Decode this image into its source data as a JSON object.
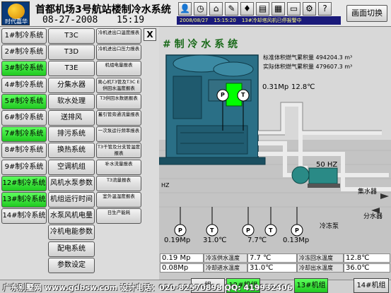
{
  "header": {
    "logo_text": "时代嘉华",
    "title": "首都机场3号航站楼制冷水系统",
    "date": "08-27-2008",
    "time": "15:19",
    "status_date": "2008/08/27",
    "status_time": "15:15:20",
    "status_message": "13#冷却塔风机已停报警中",
    "switch_button": "画面切换"
  },
  "menu": {
    "systems": [
      {
        "label": "1#制冷系统",
        "active": false
      },
      {
        "label": "2#制冷系统",
        "active": false
      },
      {
        "label": "3#制冷系统",
        "active": true
      },
      {
        "label": "4#制冷系统",
        "active": false
      },
      {
        "label": "5#制冷系统",
        "active": true
      },
      {
        "label": "6#制冷系统",
        "active": false
      },
      {
        "label": "7#制冷系统",
        "active": true
      },
      {
        "label": "8#制冷系统",
        "active": false
      },
      {
        "label": "9#制冷系统",
        "active": false
      },
      {
        "label": "12#制冷系统",
        "active": true
      },
      {
        "label": "13#制冷系统",
        "active": true
      },
      {
        "label": "14#制冷系统",
        "active": false
      }
    ],
    "col2": [
      "T3C",
      "T3D",
      "T3E",
      "分集水器",
      "软水处理",
      "送排风",
      "排污系统",
      "换热系统",
      "空调机组",
      "风机水泵参数",
      "机组运行时间",
      "水泵风机电量",
      "冷机电能参数",
      "配电系统",
      "参数设定"
    ],
    "col3": [
      "冷机进出口温度报表",
      "冷机进出口压力报表",
      "机组电量报表",
      "离心机T3管及T3C E供回水温度报表",
      "T3供回水数据报表",
      "蓄引管旁通流量报表",
      "一次泵运行频率报表",
      "T3干管及分支管温度报表",
      "补水流量报表",
      "T3流量报表",
      "室外温湿度报表",
      "日生产能耗"
    ],
    "close_label": "X"
  },
  "scene": {
    "title": "# 制 冷 水 系 统",
    "standard_volume_label": "标准体积燃气累积量",
    "standard_volume_value": "494204.3",
    "actual_volume_label": "实际体积燃气累积量",
    "actual_volume_value": "479607.3",
    "volume_unit": "m³",
    "top_pressure": "0.31Mp",
    "top_temp": "12.8℃",
    "pump_freq": "50 HZ",
    "collector_label": "集水器",
    "distributor_label": "分水器",
    "pump_label": "冷冻泵",
    "hz_left": "HZ",
    "gauges": [
      "P",
      "T",
      "P",
      "T",
      "P",
      "P",
      "T"
    ],
    "left_pressure": "0.19Mp",
    "mid_temp": "31.0℃",
    "mid_temp_2": "7.7℃",
    "right_pressure": "0.13Mp"
  },
  "table": {
    "rows": [
      {
        "left_value": "0.19 Mp",
        "label1": "冷冻供水温度",
        "value1": "7.7 ℃",
        "label2": "冷冻回水温度",
        "value2": "12.8℃"
      },
      {
        "left_value": "0.08Mp",
        "label1": "冷却进水温度",
        "value1": "31.0℃",
        "label2": "冷却出水温度",
        "value2": "36.0℃"
      }
    ]
  },
  "footer": {
    "text": "广东别墅网 www.gdbsw.com   设计电话：020-82570898  QQ: 419932406",
    "buttons": [
      {
        "label": "组",
        "active": false
      },
      {
        "label": "12#机组",
        "active": true
      },
      {
        "label": "13#机组",
        "active": true
      },
      {
        "label": "14#机组",
        "active": false
      }
    ]
  },
  "colors": {
    "active_green": "#33e633",
    "pipe": "#ececec",
    "machine": "#2a6f86",
    "window_light": "#00ff00"
  }
}
